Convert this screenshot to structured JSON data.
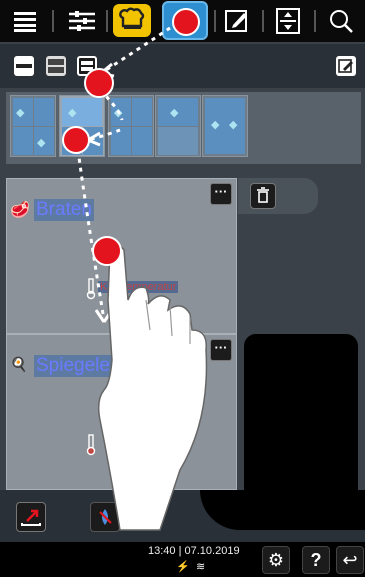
{
  "toolbar": {
    "items": [
      {
        "name": "menu",
        "icon": "hamburger-menu-icon"
      },
      {
        "name": "settings",
        "icon": "sliders-icon"
      },
      {
        "name": "chef",
        "icon": "chef-hat-icon"
      },
      {
        "name": "cook-mode",
        "icon": "fish-icon"
      },
      {
        "name": "edit",
        "icon": "edit-icon"
      },
      {
        "name": "split",
        "icon": "split-view-icon"
      },
      {
        "name": "search",
        "icon": "search-icon"
      }
    ]
  },
  "cards": [
    {
      "title": "Braten",
      "subtitle": "Kerntemperatur"
    },
    {
      "title": "Spiegelei",
      "subtitle": ""
    }
  ],
  "status": {
    "time": "13:40",
    "date": "07.10.2019"
  },
  "colors": {
    "accent_blue": "#2d8fd0",
    "highlight_yellow": "#f2c300",
    "marker_red": "#e3141e"
  }
}
